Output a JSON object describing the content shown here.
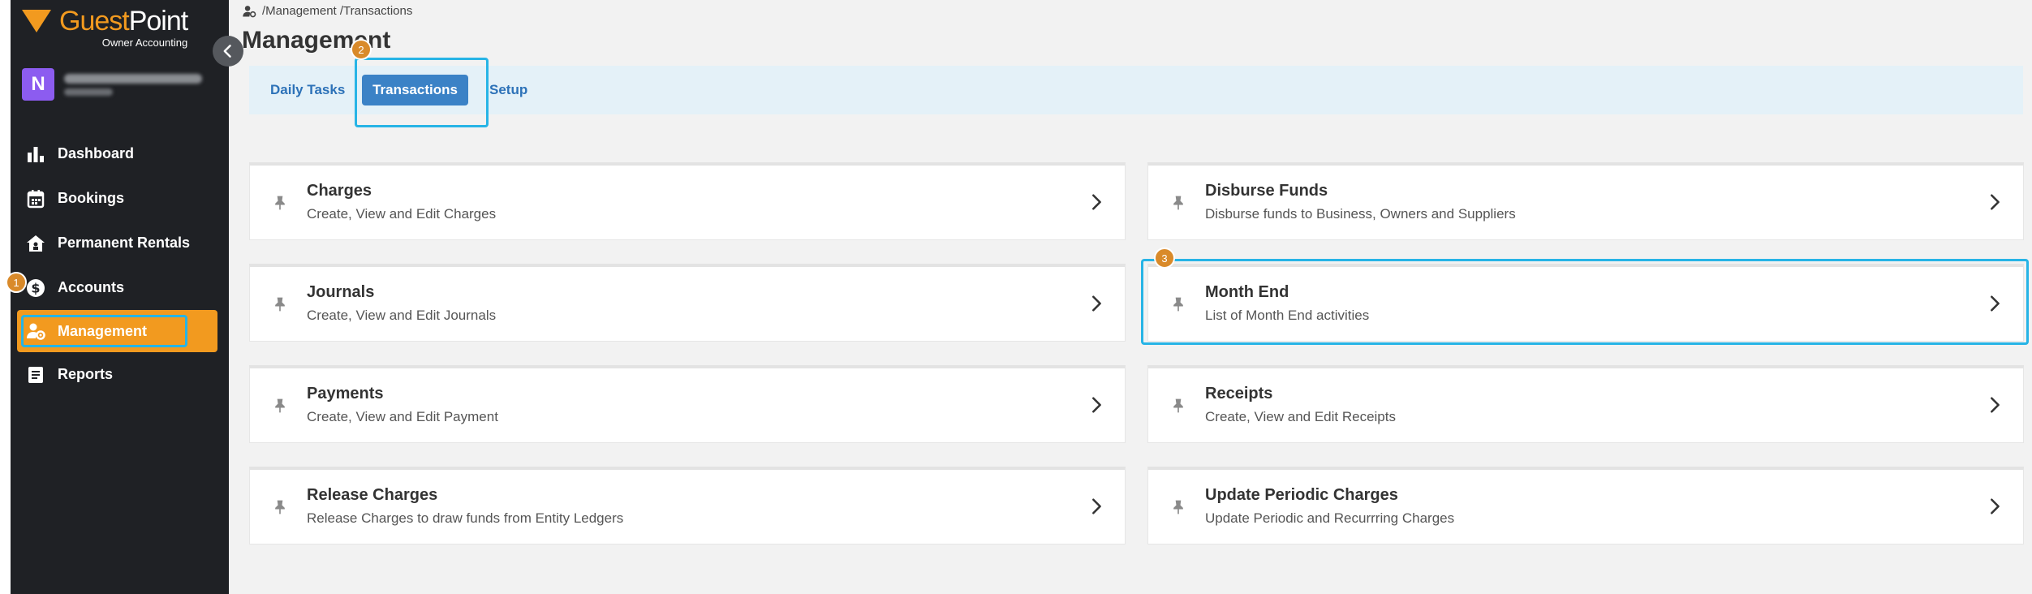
{
  "app": {
    "brand_part1": "Guest",
    "brand_part2": "Point",
    "brand_sub": "Owner Accounting"
  },
  "org": {
    "initial": "N"
  },
  "sidebar": {
    "items": [
      {
        "label": "Dashboard",
        "icon": "bar-chart-icon"
      },
      {
        "label": "Bookings",
        "icon": "calendar-icon"
      },
      {
        "label": "Permanent Rentals",
        "icon": "house-icon"
      },
      {
        "label": "Accounts",
        "icon": "dollar-icon"
      },
      {
        "label": "Management",
        "icon": "user-gear-icon",
        "active": true
      },
      {
        "label": "Reports",
        "icon": "document-icon"
      }
    ]
  },
  "badges": {
    "accounts": "1",
    "transactions_tab": "2",
    "month_end": "3"
  },
  "breadcrumb": {
    "text": "/Management /Transactions"
  },
  "page": {
    "title": "Management"
  },
  "tabs": [
    {
      "label": "Daily Tasks"
    },
    {
      "label": "Transactions",
      "active": true
    },
    {
      "label": "Setup"
    }
  ],
  "cards": [
    {
      "title": "Charges",
      "desc": "Create, View and Edit Charges"
    },
    {
      "title": "Disburse Funds",
      "desc": "Disburse funds to Business, Owners and Suppliers"
    },
    {
      "title": "Journals",
      "desc": "Create, View and Edit Journals"
    },
    {
      "title": "Month End",
      "desc": "List of Month End activities"
    },
    {
      "title": "Payments",
      "desc": "Create, View and Edit Payment"
    },
    {
      "title": "Receipts",
      "desc": "Create, View and Edit Receipts"
    },
    {
      "title": "Release Charges",
      "desc": "Release Charges to draw funds from Entity Ledgers"
    },
    {
      "title": "Update Periodic Charges",
      "desc": "Update Periodic and Recurrring Charges"
    }
  ],
  "colors": {
    "accent": "#f29a1f",
    "sidebar_bg": "#1f2125",
    "tab_active": "#3b82c6",
    "highlight": "#27b4e6",
    "badge": "#d98a2a"
  }
}
